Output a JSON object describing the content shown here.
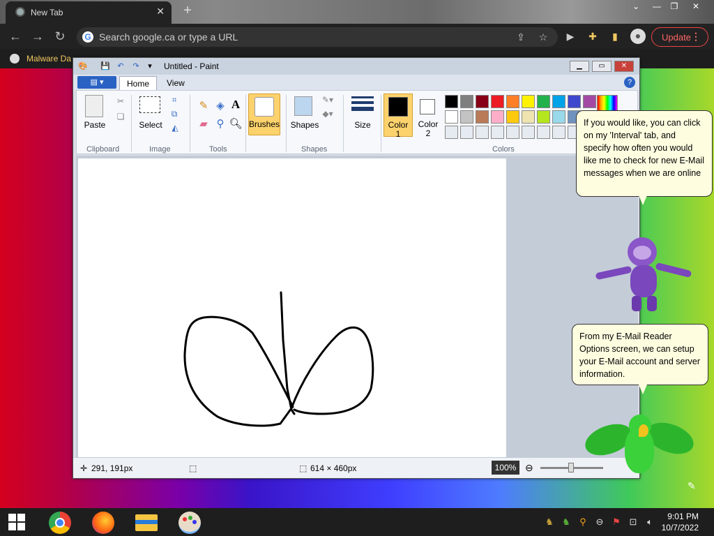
{
  "browser": {
    "tab_title": "New Tab",
    "tab_close": "✕",
    "new_tab": "+",
    "omnibox_placeholder": "Search google.ca or type a URL",
    "update_label": "Update",
    "bookmark_label": "Malware Da"
  },
  "paint": {
    "title": "Untitled - Paint",
    "tabs": [
      "Home",
      "View"
    ],
    "groups": {
      "clipboard": "Clipboard",
      "image": "Image",
      "tools": "Tools",
      "shapes": "Shapes",
      "colors": "Colors"
    },
    "buttons": {
      "paste": "Paste",
      "select": "Select",
      "brushes": "Brushes",
      "shapes": "Shapes",
      "size": "Size",
      "color1_line1": "Color",
      "color1_line2": "1",
      "color2_line1": "Color",
      "color2_line2": "2"
    },
    "palette_row1": [
      "#000000",
      "#7f7f7f",
      "#880015",
      "#ed1c24",
      "#ff7f27",
      "#fff200",
      "#22b14c",
      "#00a2e8",
      "#3f48cc",
      "#a349a4"
    ],
    "palette_row2": [
      "#ffffff",
      "#c3c3c3",
      "#b97a57",
      "#ffaec9",
      "#ffc90e",
      "#efe4b0",
      "#b5e61d",
      "#99d9ea",
      "#7092be",
      "#c8bfe7"
    ],
    "status": {
      "cursor_pos": "291, 191px",
      "canvas_size": "614 × 460px",
      "zoom": "100%"
    }
  },
  "bonzi": {
    "bubble1": "If you would like, you can click on my 'Interval' tab, and specify how often you would like me to check for new E-Mail messages when we are online",
    "bubble2": "From my E-Mail Reader Options screen, we can setup your E-Mail account and server information."
  },
  "taskbar": {
    "time": "9:01 PM",
    "date": "10/7/2022"
  }
}
